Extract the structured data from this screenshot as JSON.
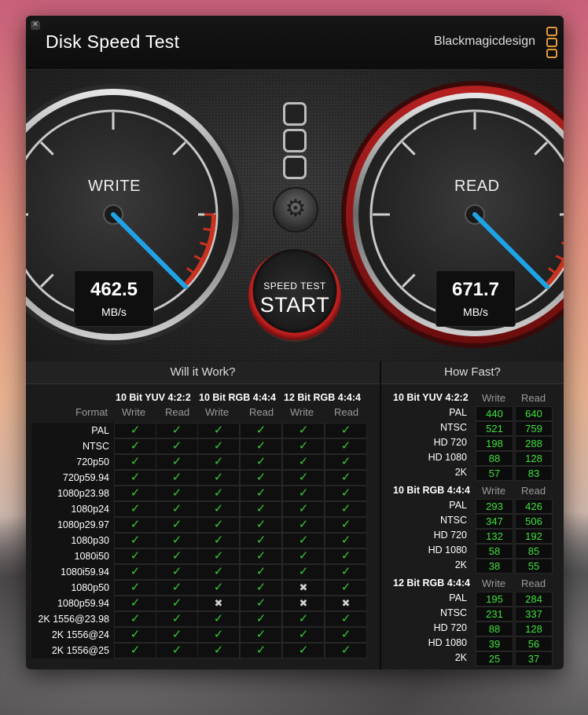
{
  "app": {
    "title": "Disk Speed Test",
    "brand": "Blackmagicdesign",
    "close_glyph": "✕"
  },
  "gauges": {
    "write": {
      "label": "WRITE",
      "value": "462.5",
      "unit": "MB/s"
    },
    "read": {
      "label": "READ",
      "value": "671.7",
      "unit": "MB/s"
    }
  },
  "controls": {
    "start_small": "SPEED TEST",
    "start_big": "START",
    "gear_icon": "gear-icon"
  },
  "will_it_work": {
    "title": "Will it Work?",
    "format_header": "Format",
    "groups": [
      {
        "name": "10 Bit YUV 4:2:2",
        "write": "Write",
        "read": "Read"
      },
      {
        "name": "10 Bit RGB 4:4:4",
        "write": "Write",
        "read": "Read"
      },
      {
        "name": "12 Bit RGB 4:4:4",
        "write": "Write",
        "read": "Read"
      }
    ],
    "rows": [
      {
        "format": "PAL",
        "marks": [
          "✓",
          "✓",
          "✓",
          "✓",
          "✓",
          "✓"
        ]
      },
      {
        "format": "NTSC",
        "marks": [
          "✓",
          "✓",
          "✓",
          "✓",
          "✓",
          "✓"
        ]
      },
      {
        "format": "720p50",
        "marks": [
          "✓",
          "✓",
          "✓",
          "✓",
          "✓",
          "✓"
        ]
      },
      {
        "format": "720p59.94",
        "marks": [
          "✓",
          "✓",
          "✓",
          "✓",
          "✓",
          "✓"
        ]
      },
      {
        "format": "1080p23.98",
        "marks": [
          "✓",
          "✓",
          "✓",
          "✓",
          "✓",
          "✓"
        ]
      },
      {
        "format": "1080p24",
        "marks": [
          "✓",
          "✓",
          "✓",
          "✓",
          "✓",
          "✓"
        ]
      },
      {
        "format": "1080p29.97",
        "marks": [
          "✓",
          "✓",
          "✓",
          "✓",
          "✓",
          "✓"
        ]
      },
      {
        "format": "1080p30",
        "marks": [
          "✓",
          "✓",
          "✓",
          "✓",
          "✓",
          "✓"
        ]
      },
      {
        "format": "1080i50",
        "marks": [
          "✓",
          "✓",
          "✓",
          "✓",
          "✓",
          "✓"
        ]
      },
      {
        "format": "1080i59.94",
        "marks": [
          "✓",
          "✓",
          "✓",
          "✓",
          "✓",
          "✓"
        ]
      },
      {
        "format": "1080p50",
        "marks": [
          "✓",
          "✓",
          "✓",
          "✓",
          "✖",
          "✓"
        ]
      },
      {
        "format": "1080p59.94",
        "marks": [
          "✓",
          "✓",
          "✖",
          "✓",
          "✖",
          "✖"
        ]
      },
      {
        "format": "2K 1556@23.98",
        "marks": [
          "✓",
          "✓",
          "✓",
          "✓",
          "✓",
          "✓"
        ]
      },
      {
        "format": "2K 1556@24",
        "marks": [
          "✓",
          "✓",
          "✓",
          "✓",
          "✓",
          "✓"
        ]
      },
      {
        "format": "2K 1556@25",
        "marks": [
          "✓",
          "✓",
          "✓",
          "✓",
          "✓",
          "✓"
        ]
      }
    ]
  },
  "how_fast": {
    "title": "How Fast?",
    "groups": [
      {
        "name": "10 Bit YUV 4:2:2",
        "write": "Write",
        "read": "Read",
        "rows": [
          {
            "label": "PAL",
            "w": "440",
            "r": "640"
          },
          {
            "label": "NTSC",
            "w": "521",
            "r": "759"
          },
          {
            "label": "HD 720",
            "w": "198",
            "r": "288"
          },
          {
            "label": "HD 1080",
            "w": "88",
            "r": "128"
          },
          {
            "label": "2K",
            "w": "57",
            "r": "83"
          }
        ]
      },
      {
        "name": "10 Bit RGB 4:4:4",
        "write": "Write",
        "read": "Read",
        "rows": [
          {
            "label": "PAL",
            "w": "293",
            "r": "426"
          },
          {
            "label": "NTSC",
            "w": "347",
            "r": "506"
          },
          {
            "label": "HD 720",
            "w": "132",
            "r": "192"
          },
          {
            "label": "HD 1080",
            "w": "58",
            "r": "85"
          },
          {
            "label": "2K",
            "w": "38",
            "r": "55"
          }
        ]
      },
      {
        "name": "12 Bit RGB 4:4:4",
        "write": "Write",
        "read": "Read",
        "rows": [
          {
            "label": "PAL",
            "w": "195",
            "r": "284"
          },
          {
            "label": "NTSC",
            "w": "231",
            "r": "337"
          },
          {
            "label": "HD 720",
            "w": "88",
            "r": "128"
          },
          {
            "label": "HD 1080",
            "w": "39",
            "r": "56"
          },
          {
            "label": "2K",
            "w": "25",
            "r": "37"
          }
        ]
      }
    ]
  },
  "colors": {
    "accent_green": "#3ee03e",
    "needle_blue": "#1fa3e6",
    "red_zone": "#c8321e",
    "brand_orange": "#e39a3a"
  }
}
